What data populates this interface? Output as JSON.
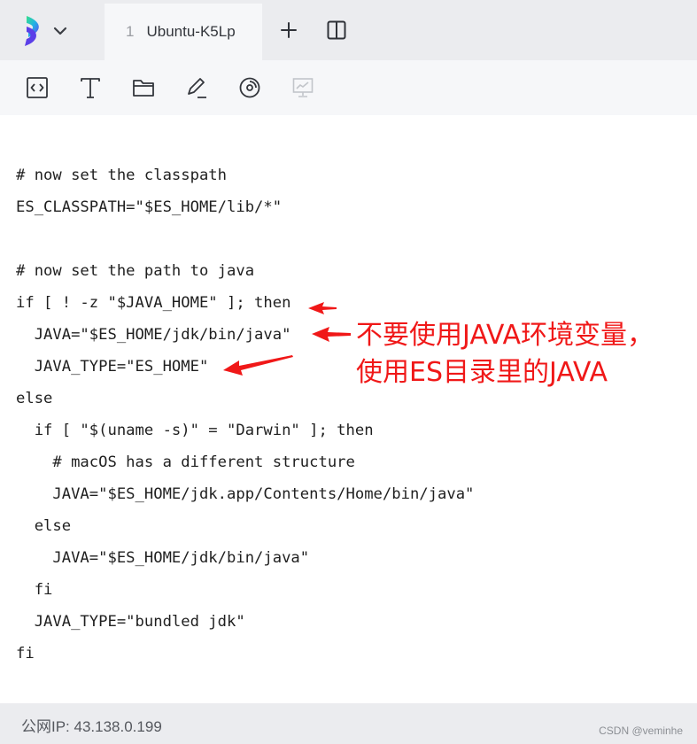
{
  "tabbar": {
    "logo_icon": "app-logo-icon",
    "tab": {
      "index": "1",
      "label": "Ubuntu-K5Lp"
    },
    "add_icon": "plus-icon",
    "split_icon": "split-view-icon"
  },
  "toolbar": {
    "tools": [
      "code-icon",
      "text-icon",
      "folder-icon",
      "edit-icon",
      "disk-icon",
      "monitor-icon"
    ]
  },
  "code": {
    "lines": [
      "# now set the classpath",
      "ES_CLASSPATH=\"$ES_HOME/lib/*\"",
      "",
      "# now set the path to java",
      "if [ ! -z \"$JAVA_HOME\" ]; then",
      "  JAVA=\"$ES_HOME/jdk/bin/java\"",
      "  JAVA_TYPE=\"ES_HOME\"",
      "else",
      "  if [ \"$(uname -s)\" = \"Darwin\" ]; then",
      "    # macOS has a different structure",
      "    JAVA=\"$ES_HOME/jdk.app/Contents/Home/bin/java\"",
      "  else",
      "    JAVA=\"$ES_HOME/jdk/bin/java\"",
      "  fi",
      "  JAVA_TYPE=\"bundled jdk\"",
      "fi"
    ]
  },
  "annotation": {
    "line1": "不要使用JAVA环境变量，",
    "line2": "使用ES目录里的JAVA",
    "color": "#f01818"
  },
  "status": {
    "ip": "公网IP: 43.138.0.199",
    "watermark": "CSDN @veminhe"
  }
}
